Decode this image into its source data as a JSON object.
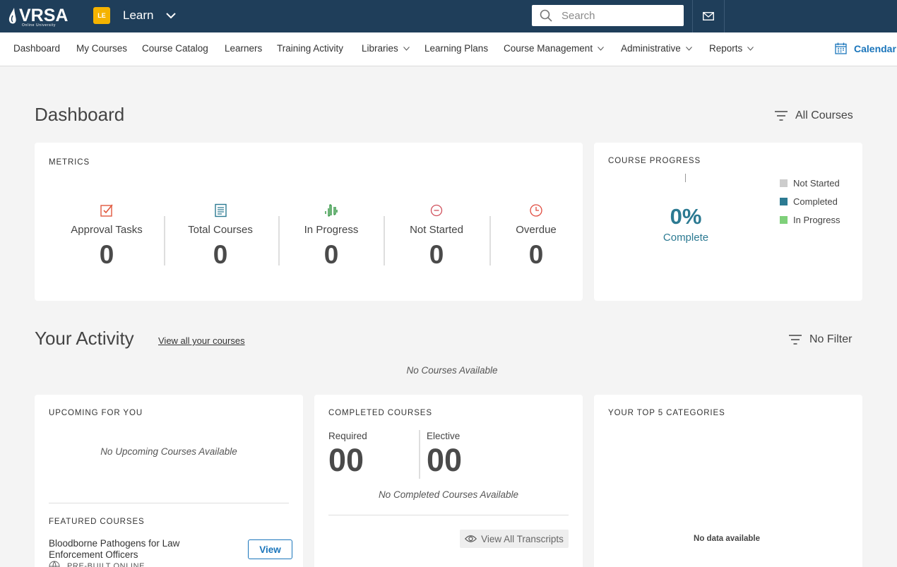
{
  "topbar": {
    "logo_text": "VRSA",
    "logo_subtitle": "Online University",
    "app_badge": "LE",
    "app_name": "Learn",
    "search_placeholder": "Search"
  },
  "nav": {
    "items": [
      {
        "label": "Dashboard",
        "dropdown": false
      },
      {
        "label": "My Courses",
        "dropdown": false
      },
      {
        "label": "Course Catalog",
        "dropdown": false
      },
      {
        "label": "Learners",
        "dropdown": false
      },
      {
        "label": "Training Activity",
        "dropdown": false
      },
      {
        "label": "Libraries",
        "dropdown": true
      },
      {
        "label": "Learning Plans",
        "dropdown": false
      },
      {
        "label": "Course Management",
        "dropdown": true
      },
      {
        "label": "Administrative",
        "dropdown": true
      },
      {
        "label": "Reports",
        "dropdown": true
      }
    ],
    "calendar_label": "Calendar"
  },
  "dashboard": {
    "title": "Dashboard",
    "filter_label": "All Courses"
  },
  "metrics": {
    "label": "METRICS",
    "items": [
      {
        "label": "Approval Tasks",
        "value": "0",
        "icon": "approval-check-icon"
      },
      {
        "label": "Total Courses",
        "value": "0",
        "icon": "document-list-icon"
      },
      {
        "label": "In Progress",
        "value": "0",
        "icon": "progress-wave-icon"
      },
      {
        "label": "Not Started",
        "value": "0",
        "icon": "minus-circle-icon"
      },
      {
        "label": "Overdue",
        "value": "0",
        "icon": "clock-icon"
      }
    ]
  },
  "course_progress": {
    "label": "COURSE PROGRESS",
    "percent": "0%",
    "subtitle": "Complete",
    "legend": [
      {
        "label": "Not Started",
        "color": "#cccccc"
      },
      {
        "label": "Completed",
        "color": "#2c7a92"
      },
      {
        "label": "In Progress",
        "color": "#7fd07a"
      }
    ]
  },
  "activity": {
    "title": "Your Activity",
    "view_all_label": "View all your courses",
    "filter_label": "No Filter",
    "empty_note": "No Courses Available"
  },
  "upcoming": {
    "label": "UPCOMING FOR YOU",
    "empty_note": "No Upcoming Courses Available",
    "featured_label": "FEATURED COURSES",
    "featured_course_title": "Bloodborne Pathogens for Law Enforcement Officers",
    "featured_course_type": "PRE-BUILT ONLINE",
    "view_button": "View"
  },
  "completed": {
    "label": "COMPLETED COURSES",
    "required_label": "Required",
    "required_value": "00",
    "elective_label": "Elective",
    "elective_value": "00",
    "empty_note": "No Completed Courses Available",
    "transcripts_button": "View All Transcripts"
  },
  "top_categories": {
    "label": "YOUR TOP 5 CATEGORIES",
    "empty_note": "No data available"
  },
  "colors": {
    "topbar": "#1f3e5a",
    "accent_blue": "#1a75bb",
    "progress_teal": "#2c7a92",
    "badge_yellow": "#f5b300"
  }
}
